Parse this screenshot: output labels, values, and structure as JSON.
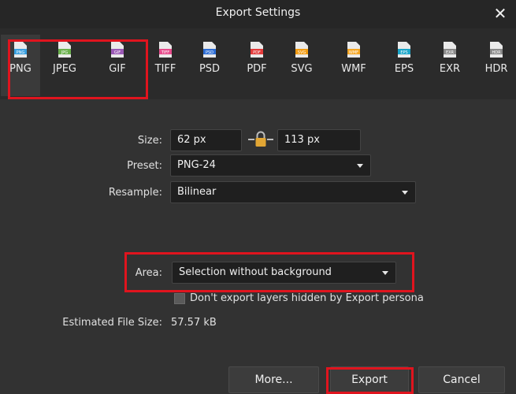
{
  "window": {
    "title": "Export Settings",
    "close_glyph": "✕"
  },
  "formats": [
    {
      "label": "PNG",
      "icon_tag": "PNG",
      "color": "#3aa0e0",
      "selected": true
    },
    {
      "label": "JPEG",
      "icon_tag": "JPG",
      "color": "#6ab04c"
    },
    {
      "label": "GIF",
      "icon_tag": "GIF",
      "color": "#9b59b6"
    },
    {
      "label": "TIFF",
      "icon_tag": "TIFF",
      "color": "#e74c8c"
    },
    {
      "label": "PSD",
      "icon_tag": "PSD",
      "color": "#2f6fd6"
    },
    {
      "label": "PDF",
      "icon_tag": "PDF",
      "color": "#e43b3b"
    },
    {
      "label": "SVG",
      "icon_tag": "SVG",
      "color": "#f39c12"
    },
    {
      "label": "WMF",
      "icon_tag": "WMF",
      "color": "#f5a623"
    },
    {
      "label": "EPS",
      "icon_tag": "EPS",
      "color": "#1aa5c8"
    },
    {
      "label": "EXR",
      "icon_tag": "EXR",
      "color": "#8a8a8a"
    },
    {
      "label": "HDR",
      "icon_tag": "HDR",
      "color": "#8a8a8a"
    }
  ],
  "form": {
    "size_label": "Size:",
    "width_value": "62 px",
    "height_value": "113 px",
    "preset_label": "Preset:",
    "preset_value": "PNG-24",
    "resample_label": "Resample:",
    "resample_value": "Bilinear",
    "area_label": "Area:",
    "area_value": "Selection without background",
    "hidden_layers_label": "Don't export layers hidden by Export persona",
    "estimated_label": "Estimated File Size:",
    "estimated_value": "57.57 kB"
  },
  "buttons": {
    "more": "More...",
    "export": "Export",
    "cancel": "Cancel"
  },
  "colors": {
    "highlight": "#e0141e",
    "lock": "#e2a634"
  }
}
